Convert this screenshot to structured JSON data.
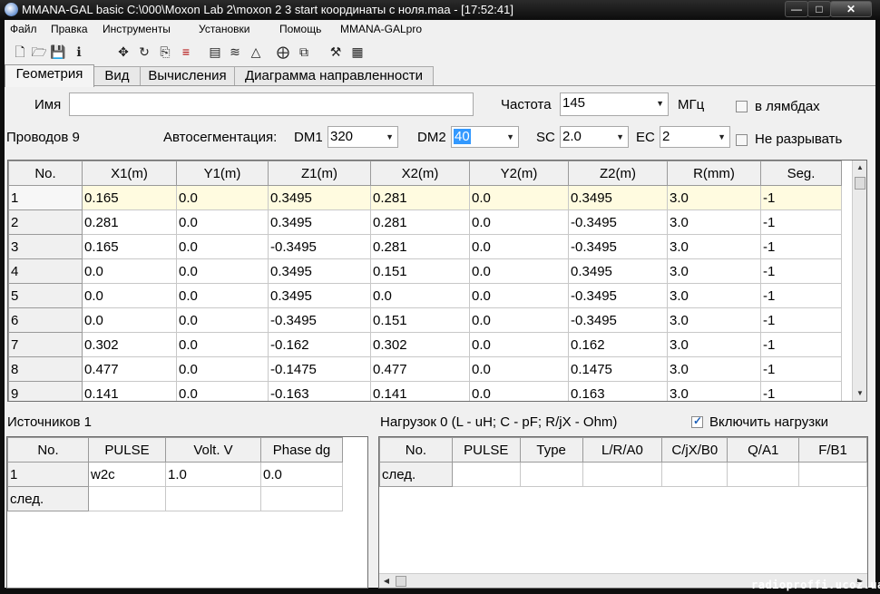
{
  "window": {
    "title": "MMANA-GAL basic C:\\000\\Moxon Lab 2\\moxon 2 3 start координаты с ноля.maa - [17:52:41]",
    "min_glyph": "—",
    "max_glyph": "□",
    "close_glyph": "✕"
  },
  "menu": [
    "Файл",
    "Правка",
    "Инструменты",
    "Установки",
    "Помощь",
    "MMANA-GALpro"
  ],
  "toolbar_icons": [
    "new-file-icon",
    "open-folder-icon",
    "save-icon",
    "info-icon",
    "move-icon",
    "rotate-icon",
    "copy-icon",
    "wires-icon",
    "document-icon",
    "stretch-icon",
    "triangle-icon",
    "target-icon",
    "duplicate-icon",
    "tools-icon",
    "calculator-icon"
  ],
  "tabs": [
    "Геометрия",
    "Вид",
    "Вычисления",
    "Диаграмма направленности"
  ],
  "geometry": {
    "name_label": "Имя",
    "name_value": "",
    "freq_label": "Частота",
    "freq_value": "145",
    "freq_unit": "МГц",
    "lambda_label": "в лямбдах",
    "wires_label": "Проводов 9",
    "autoseg_label": "Автосегментация:",
    "dm1_label": "DM1",
    "dm1_value": "320",
    "dm2_label": "DM2",
    "dm2_value": "40",
    "sc_label": "SC",
    "sc_value": "2.0",
    "ec_label": "EC",
    "ec_value": "2",
    "nobreak_label": "Не разрывать"
  },
  "wires_table": {
    "headers": [
      "No.",
      "X1(m)",
      "Y1(m)",
      "Z1(m)",
      "X2(m)",
      "Y2(m)",
      "Z2(m)",
      "R(mm)",
      "Seg."
    ],
    "rows": [
      [
        "1",
        "0.165",
        "0.0",
        "0.3495",
        "0.281",
        "0.0",
        "0.3495",
        "3.0",
        "-1"
      ],
      [
        "2",
        "0.281",
        "0.0",
        "0.3495",
        "0.281",
        "0.0",
        "-0.3495",
        "3.0",
        "-1"
      ],
      [
        "3",
        "0.165",
        "0.0",
        "-0.3495",
        "0.281",
        "0.0",
        "-0.3495",
        "3.0",
        "-1"
      ],
      [
        "4",
        "0.0",
        "0.0",
        "0.3495",
        "0.151",
        "0.0",
        "0.3495",
        "3.0",
        "-1"
      ],
      [
        "5",
        "0.0",
        "0.0",
        "0.3495",
        "0.0",
        "0.0",
        "-0.3495",
        "3.0",
        "-1"
      ],
      [
        "6",
        "0.0",
        "0.0",
        "-0.3495",
        "0.151",
        "0.0",
        "-0.3495",
        "3.0",
        "-1"
      ],
      [
        "7",
        "0.302",
        "0.0",
        "-0.162",
        "0.302",
        "0.0",
        "0.162",
        "3.0",
        "-1"
      ],
      [
        "8",
        "0.477",
        "0.0",
        "-0.1475",
        "0.477",
        "0.0",
        "0.1475",
        "3.0",
        "-1"
      ],
      [
        "9",
        "0.141",
        "0.0",
        "-0.163",
        "0.141",
        "0.0",
        "0.163",
        "3.0",
        "-1"
      ]
    ]
  },
  "sources": {
    "label": "Источников 1",
    "headers": [
      "No.",
      "PULSE",
      "Volt. V",
      "Phase dg"
    ],
    "rows": [
      [
        "1",
        "w2c",
        "1.0",
        "0.0"
      ],
      [
        "след.",
        "",
        "",
        ""
      ]
    ]
  },
  "loads": {
    "label": "Нагрузок 0 (L - uH; C - pF; R/jX - Ohm)",
    "enable_label": "Включить нагрузки",
    "enable_checked": true,
    "headers": [
      "No.",
      "PULSE",
      "Type",
      "L/R/A0",
      "C/jX/B0",
      "Q/A1",
      "F/B1"
    ],
    "rows": [
      [
        "след.",
        "",
        "",
        "",
        "",
        "",
        ""
      ]
    ]
  },
  "watermark": "radioproffi.ucoz.ua"
}
